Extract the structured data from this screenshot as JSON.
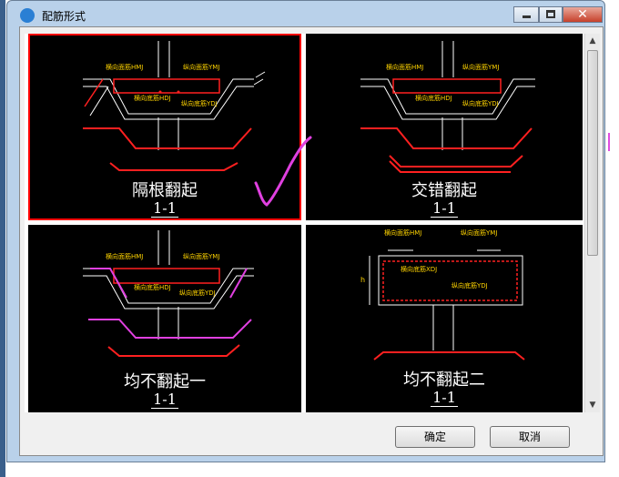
{
  "window": {
    "title": "配筋形式"
  },
  "options": [
    {
      "caption": "隔根翻起",
      "section": "1-1",
      "selected": true
    },
    {
      "caption": "交错翻起",
      "section": "1-1",
      "selected": false
    },
    {
      "caption": "均不翻起一",
      "section": "1-1",
      "selected": false
    },
    {
      "caption": "均不翻起二",
      "section": "1-1",
      "selected": false
    }
  ],
  "labels": {
    "hd": "横向面筋HMJ",
    "zm": "纵向面筋YMJ",
    "hdj": "横向底筋HDJ",
    "zdj": "纵向底筋YDJ",
    "hdj2": "横向底筋XDJ",
    "zmj2": "纵向面筋YMJ",
    "h": "h"
  },
  "buttons": {
    "ok": "确定",
    "cancel": "取消"
  }
}
